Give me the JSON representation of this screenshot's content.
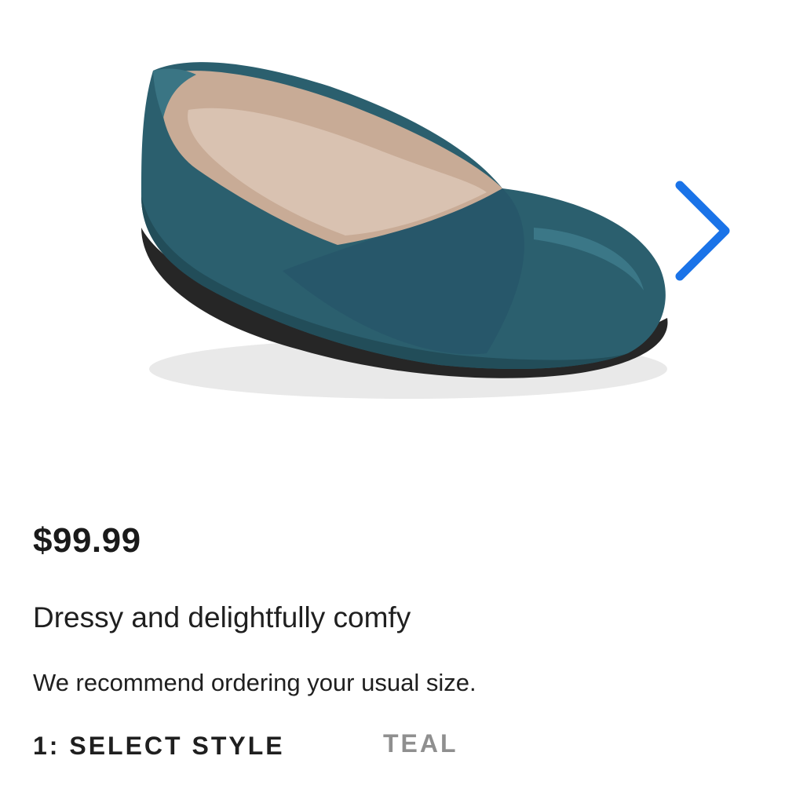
{
  "gallery": {
    "image_icon": "teal-ballet-flat-shoe",
    "next_icon": "chevron-right-icon",
    "accent_color": "#1a73e8",
    "shoe_color": "#2b5f6e"
  },
  "product": {
    "price": "$99.99",
    "tagline": "Dressy and delightfully comfy",
    "size_note": "We recommend ordering your usual size."
  },
  "style_selector": {
    "label": "1: SELECT STYLE",
    "selected_value": "TEAL"
  }
}
